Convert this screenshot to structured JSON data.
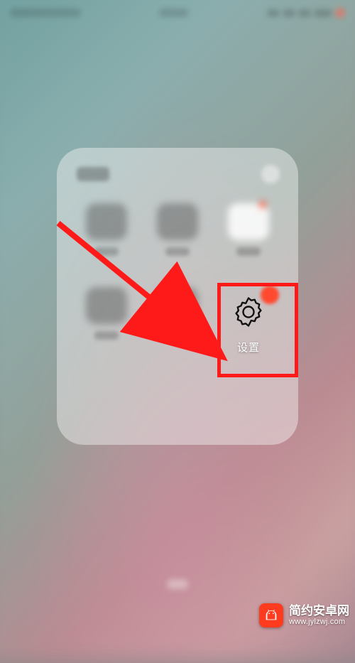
{
  "statusbar": {
    "carrier": "",
    "time": "",
    "battery": ""
  },
  "folder": {
    "title": "工具",
    "apps": [
      {
        "label": ""
      },
      {
        "label": ""
      },
      {
        "label": ""
      },
      {
        "label": ""
      },
      {
        "label": ""
      },
      {
        "label": "设置",
        "isSettings": true
      }
    ]
  },
  "annotation": {
    "highlight_target": "settings-app",
    "box_color": "#ff1a1a"
  },
  "watermark": {
    "brand_cn": "简约安卓网",
    "brand_url": "www.jylzwj.com"
  }
}
